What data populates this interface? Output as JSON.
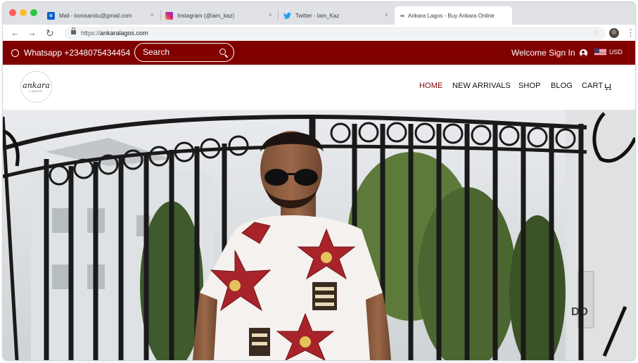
{
  "browser": {
    "tabs": [
      {
        "label": "Mail - konisarotu@gmail.com",
        "icon": "outlook-icon"
      },
      {
        "label": "Instagram (@iam_kaz)",
        "icon": "instagram-icon"
      },
      {
        "label": "Twitter - Iam_Kaz",
        "icon": "twitter-icon"
      },
      {
        "label": "Ankara Lagos - Buy Ankara Online",
        "icon": "site-favicon-icon",
        "active": true
      }
    ],
    "close_glyph": "×",
    "url_scheme": "https://",
    "url_host": "ankaralagos.com",
    "back_glyph": "←",
    "forward_glyph": "→",
    "reload_glyph": "↻",
    "star_glyph": "☆",
    "menu_glyph": "⋮"
  },
  "topbar": {
    "whatsapp": "Whatsapp +2348075434454",
    "search_placeholder": "Search",
    "welcome": "Welcome Sign In",
    "currency": "USD",
    "bg_color": "#800000"
  },
  "logo": {
    "text": "ankara",
    "subtext": "LAGOS"
  },
  "nav": {
    "home": "HOME",
    "new_arrivals": "NEW ARRIVALS",
    "shop": "SHOP",
    "blog": "BLOG",
    "cart": "CART"
  },
  "hero": {
    "sign_text": "DO"
  },
  "colors": {
    "accent": "#800000",
    "tab_strip": "#dfe1e5",
    "traffic_red": "#fe5f57",
    "traffic_yellow": "#febc2e",
    "traffic_green": "#28c840"
  }
}
